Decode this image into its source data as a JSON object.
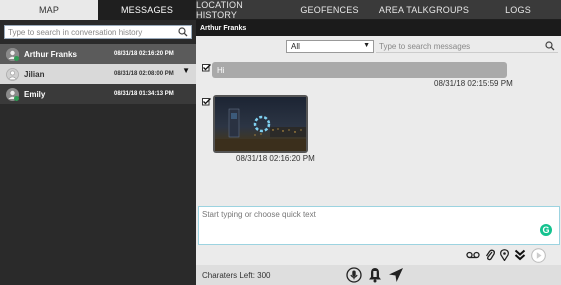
{
  "tabs": [
    {
      "label": "MAP"
    },
    {
      "label": "MESSAGES"
    },
    {
      "label": "LOCATION HISTORY"
    },
    {
      "label": "GEOFENCES"
    },
    {
      "label": "AREA TALKGROUPS"
    },
    {
      "label": "LOGS"
    }
  ],
  "conversations": {
    "search_placeholder": "Type to search in conversation history",
    "items": [
      {
        "name": "Arthur Franks",
        "time": "08/31/18 02:16:20 PM"
      },
      {
        "name": "Jilian",
        "time": "08/31/18 02:08:00 PM"
      },
      {
        "name": "Emily",
        "time": "08/31/18 01:34:13 PM"
      }
    ]
  },
  "chat": {
    "title": "Arthur Franks",
    "filter": "All",
    "search_placeholder": "Type to search messages",
    "messages": [
      {
        "text": "Hi",
        "time": "08/31/18 02:15:59 PM"
      },
      {
        "text": "",
        "time": "08/31/18 02:16:20 PM"
      }
    ],
    "compose_placeholder": "Start typing or choose quick text",
    "chars_left": "Charaters Left: 300"
  },
  "colors": {
    "accent": "#14c28f",
    "header": "#1b1b1b",
    "online": "#2f9b54"
  }
}
